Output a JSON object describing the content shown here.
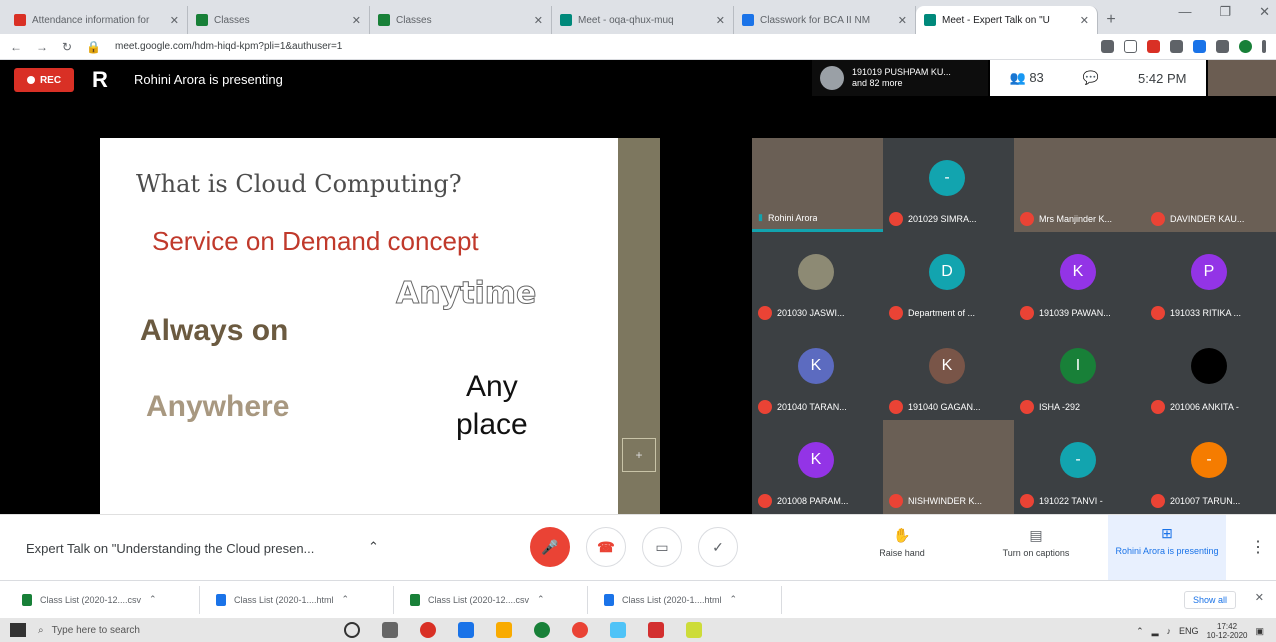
{
  "browser": {
    "tabs": [
      {
        "label": "Attendance information for",
        "color": "#d93025"
      },
      {
        "label": "Classes",
        "color": "#188038"
      },
      {
        "label": "Classes",
        "color": "#188038"
      },
      {
        "label": "Meet - oqa-qhux-muq",
        "color": "#00897b"
      },
      {
        "label": "Classwork for BCA II NM",
        "color": "#1a73e8"
      },
      {
        "label": "Meet - Expert Talk on \"U",
        "color": "#00897b"
      }
    ],
    "new_tab": "+",
    "url": "meet.google.com/hdm-hiqd-kpm?pli=1&authuser=1",
    "window_controls": [
      "—",
      "❐",
      "✕"
    ]
  },
  "meet": {
    "rec_label": "REC",
    "presenter_text": "Rohini Arora is presenting",
    "joined": {
      "line1": "191019 PUSHPAM KU...",
      "line2": "and 82 more"
    },
    "people_count": "83",
    "time": "5:42 PM",
    "title": "Expert Talk on \"Understanding the Cloud presen...",
    "raise_hand": "Raise hand",
    "captions": "Turn on captions",
    "presenting": "Rohini Arora is presenting"
  },
  "slide": {
    "title": "What is Cloud Computing?",
    "subtitle": "Service on Demand concept",
    "anytime": "Anytime",
    "always_on": "Always on",
    "any_place_1": "Any",
    "any_place_2": "place",
    "anywhere": "Anywhere",
    "nav": "+"
  },
  "participants": [
    {
      "name": "Rohini Arora",
      "initial": "",
      "color": "#6a5f55",
      "video": true
    },
    {
      "name": "201029 SIMRA...",
      "initial": "-",
      "color": "#12a4af",
      "video": false
    },
    {
      "name": "Mrs Manjinder K...",
      "initial": "",
      "color": "#6a5f55",
      "video": true
    },
    {
      "name": "DAVINDER KAU...",
      "initial": "",
      "color": "#6a5f55",
      "video": true
    },
    {
      "name": "201030 JASWI...",
      "initial": "",
      "color": "#8d8a74",
      "video": false
    },
    {
      "name": "Department of ...",
      "initial": "D",
      "color": "#12a4af",
      "video": false
    },
    {
      "name": "191039 PAWAN...",
      "initial": "K",
      "color": "#9334e6",
      "video": false
    },
    {
      "name": "191033 RITIKA ...",
      "initial": "P",
      "color": "#9334e6",
      "video": false
    },
    {
      "name": "201040 TARAN...",
      "initial": "K",
      "color": "#5c6bc0",
      "video": false
    },
    {
      "name": "191040 GAGAN...",
      "initial": "K",
      "color": "#795548",
      "video": false
    },
    {
      "name": "ISHA -292",
      "initial": "I",
      "color": "#188038",
      "video": false
    },
    {
      "name": "201006 ANKITA -",
      "initial": "",
      "color": "#000000",
      "video": false
    },
    {
      "name": "201008 PARAM...",
      "initial": "K",
      "color": "#9334e6",
      "video": false
    },
    {
      "name": "NISHWINDER K...",
      "initial": "",
      "color": "#6a5f55",
      "video": true
    },
    {
      "name": "191022 TANVI -",
      "initial": "-",
      "color": "#12a4af",
      "video": false
    },
    {
      "name": "201007 TARUN...",
      "initial": "-",
      "color": "#f57c00",
      "video": false
    }
  ],
  "downloads": [
    {
      "label": "Class List (2020-12....csv",
      "color": "#188038"
    },
    {
      "label": "Class List (2020-1....html",
      "color": "#1a73e8"
    },
    {
      "label": "Class List (2020-12....csv",
      "color": "#188038"
    },
    {
      "label": "Class List (2020-1....html",
      "color": "#1a73e8"
    }
  ],
  "download_show_all": "Show all",
  "taskbar": {
    "search_placeholder": "Type here to search",
    "time": "17:42",
    "date": "10-12-2020",
    "lang": "ENG"
  }
}
